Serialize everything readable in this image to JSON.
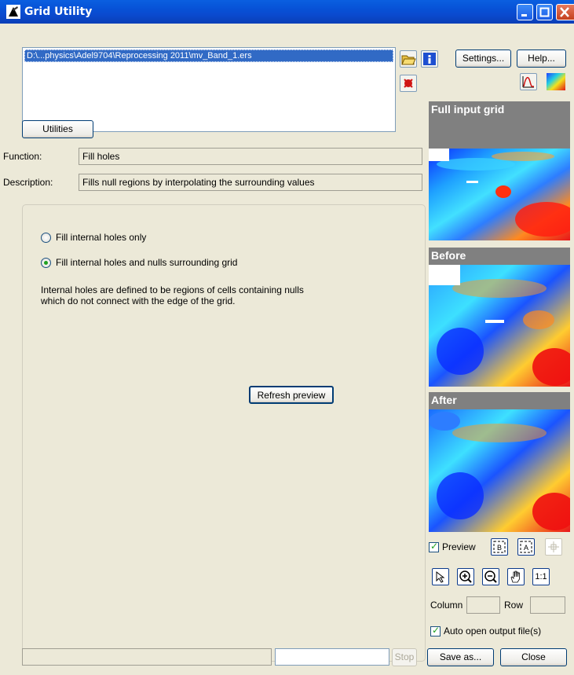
{
  "window": {
    "title": "Grid Utility"
  },
  "file_list": {
    "items": [
      "D:\\...physics\\Adel9704\\Reprocessing 2011\\mv_Band_1.ers"
    ]
  },
  "toolbar": {
    "settings_label": "Settings...",
    "help_label": "Help...",
    "open_icon": "folder-open-icon",
    "info_icon": "info-icon",
    "remove_icon": "remove-file-icon",
    "histogram_icon": "histogram-icon",
    "colour_icon": "colour-table-icon"
  },
  "utilities": {
    "button_label": "Utilities",
    "function_label": "Function:",
    "function_value": "Fill holes",
    "description_label": "Description:",
    "description_value": "Fills null regions by interpolating the surrounding values"
  },
  "options": {
    "radio_1": "Fill internal holes only",
    "radio_2": "Fill internal holes and nulls surrounding grid",
    "selected": 2,
    "note_line_1": "Internal holes are defined to be regions of cells containing nulls",
    "note_line_2": "which do not connect with the edge of the grid.",
    "refresh_label": "Refresh preview"
  },
  "previews": {
    "full_label": "Full input grid",
    "before_label": "Before",
    "after_label": "After"
  },
  "preview_controls": {
    "preview_label": "Preview",
    "preview_checked": true,
    "one_to_one_label": "1:1",
    "column_label": "Column",
    "row_label": "Row",
    "column_value": "",
    "row_value": "",
    "auto_open_label": "Auto open output file(s)",
    "auto_open_checked": true
  },
  "footer": {
    "stop_label": "Stop",
    "save_label": "Save as...",
    "close_label": "Close"
  },
  "colors": {
    "title_bar": "#0a56d8",
    "selection": "#316ac5",
    "window_bg": "#ece9d8",
    "preview_header": "#808080"
  }
}
